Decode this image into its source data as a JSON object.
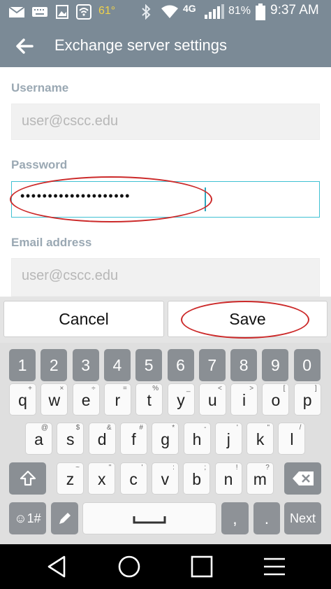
{
  "status_bar": {
    "temperature": "61°",
    "network": "4G",
    "battery_percent": "81%",
    "time": "9:37 AM",
    "icons": [
      "email-icon",
      "keyboard-icon",
      "image-icon",
      "wifi-icon",
      "bluetooth-icon",
      "wifi-signal-icon",
      "signal-bars-icon",
      "battery-icon"
    ]
  },
  "app_bar": {
    "title": "Exchange server settings",
    "back_icon": "arrow-left-icon"
  },
  "form": {
    "username_label": "Username",
    "username_placeholder": "user@cscc.edu",
    "password_label": "Password",
    "password_value": "••••••••••••••••••••",
    "email_label": "Email address",
    "email_placeholder": "user@cscc.edu"
  },
  "actions": {
    "cancel_label": "Cancel",
    "save_label": "Save"
  },
  "keyboard": {
    "row_numbers": [
      "1",
      "2",
      "3",
      "4",
      "5",
      "6",
      "7",
      "8",
      "9",
      "0"
    ],
    "row1": [
      {
        "k": "q",
        "s": "+"
      },
      {
        "k": "w",
        "s": "×"
      },
      {
        "k": "e",
        "s": "÷"
      },
      {
        "k": "r",
        "s": "="
      },
      {
        "k": "t",
        "s": "%"
      },
      {
        "k": "y",
        "s": "_"
      },
      {
        "k": "u",
        "s": "<"
      },
      {
        "k": "i",
        "s": ">"
      },
      {
        "k": "o",
        "s": "["
      },
      {
        "k": "p",
        "s": "]"
      }
    ],
    "row2": [
      {
        "k": "a",
        "s": "@"
      },
      {
        "k": "s",
        "s": "$"
      },
      {
        "k": "d",
        "s": "&"
      },
      {
        "k": "f",
        "s": "#"
      },
      {
        "k": "g",
        "s": "*"
      },
      {
        "k": "h",
        "s": "-"
      },
      {
        "k": "j",
        "s": "'"
      },
      {
        "k": "k",
        "s": "\""
      },
      {
        "k": "l",
        "s": "/"
      }
    ],
    "row3": [
      {
        "k": "z",
        "s": "~"
      },
      {
        "k": "x",
        "s": "\""
      },
      {
        "k": "c",
        "s": "'"
      },
      {
        "k": "v",
        "s": ":"
      },
      {
        "k": "b",
        "s": ";"
      },
      {
        "k": "n",
        "s": "!"
      },
      {
        "k": "m",
        "s": "?"
      }
    ],
    "emoji_label": "☺1#",
    "comma_label": ",",
    "period_label": ".",
    "next_label": "Next"
  },
  "nav_bar": {
    "icons": [
      "back-triangle-icon",
      "home-circle-icon",
      "recents-square-icon",
      "menu-icon"
    ]
  }
}
